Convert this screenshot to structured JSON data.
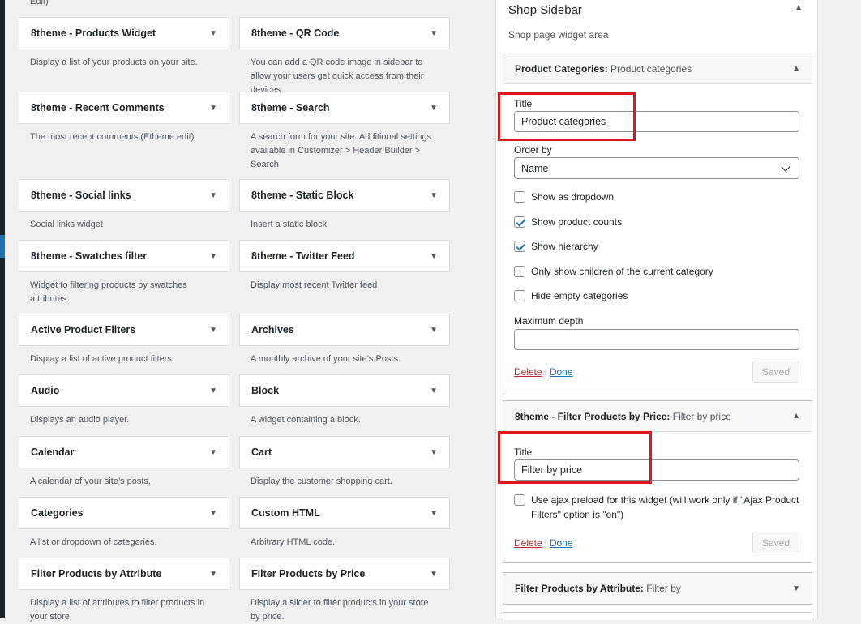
{
  "top_cut_text": "Edit)",
  "widgets": [
    {
      "name": "8theme - Products Widget",
      "desc": "Display a list of your products on your site."
    },
    {
      "name": "8theme - QR Code",
      "desc": "You can add a QR code image in sidebar to allow your users get quick access from their devices"
    },
    {
      "name": "8theme - Recent Comments",
      "desc": "The most recent comments (Etheme edit)"
    },
    {
      "name": "8theme - Search",
      "desc": "A search form for your site. Additional settings available in Customizer > Header Builder > Search"
    },
    {
      "name": "8theme - Social links",
      "desc": "Social links widget"
    },
    {
      "name": "8theme - Static Block",
      "desc": "Insert a static block"
    },
    {
      "name": "8theme - Swatches filter",
      "desc": "Widget to filtering products by swatches attributes"
    },
    {
      "name": "8theme - Twitter Feed",
      "desc": "Display most recent Twitter feed"
    },
    {
      "name": "Active Product Filters",
      "desc": "Display a list of active product filters."
    },
    {
      "name": "Archives",
      "desc": "A monthly archive of your site’s Posts."
    },
    {
      "name": "Audio",
      "desc": "Displays an audio player."
    },
    {
      "name": "Block",
      "desc": "A widget containing a block."
    },
    {
      "name": "Calendar",
      "desc": "A calendar of your site’s posts."
    },
    {
      "name": "Cart",
      "desc": "Display the customer shopping cart."
    },
    {
      "name": "Categories",
      "desc": "A list or dropdown of categories."
    },
    {
      "name": "Custom HTML",
      "desc": "Arbitrary HTML code."
    },
    {
      "name": "Filter Products by Attribute",
      "desc": "Display a list of attributes to filter products in your store."
    },
    {
      "name": "Filter Products by Price",
      "desc": "Display a slider to filter products in your store by price."
    }
  ],
  "sidebar": {
    "title": "Shop Sidebar",
    "desc": "Shop page widget area",
    "w1": {
      "name": "Product Categories:",
      "subtitle": "Product categories",
      "title_label": "Title",
      "title_value": "Product categories",
      "orderby_label": "Order by",
      "orderby_value": "Name",
      "checks": [
        {
          "label": "Show as dropdown",
          "checked": false
        },
        {
          "label": "Show product counts",
          "checked": true
        },
        {
          "label": "Show hierarchy",
          "checked": true
        },
        {
          "label": "Only show children of the current category",
          "checked": false
        },
        {
          "label": "Hide empty categories",
          "checked": false
        }
      ],
      "depth_label": "Maximum depth",
      "depth_value": "",
      "delete": "Delete",
      "sep": "|",
      "done": "Done",
      "saved": "Saved"
    },
    "w2": {
      "name": "8theme - Filter Products by Price:",
      "subtitle": "Filter by price",
      "title_label": "Title",
      "title_value": "Filter by price",
      "ajax_label": "Use ajax preload for this widget (will work only if \"Ajax Product Filters\" option is \"on\")",
      "delete": "Delete",
      "sep": "|",
      "done": "Done",
      "saved": "Saved"
    },
    "w3": {
      "name": "Filter Products by Attribute:",
      "subtitle": "Filter by"
    }
  }
}
